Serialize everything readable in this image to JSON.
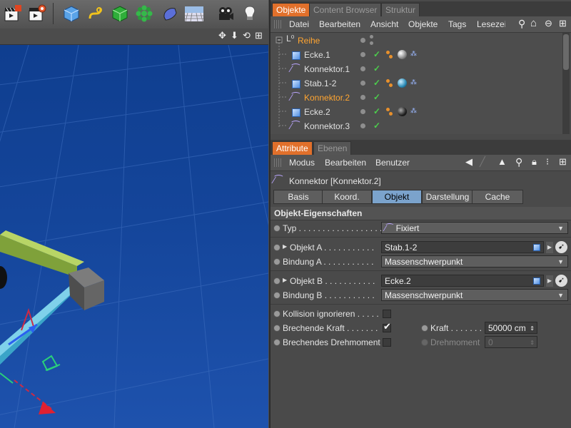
{
  "toolbar": {
    "icons": [
      "render-active-view-icon",
      "render-settings-icon",
      "cube-primitive-icon",
      "spline-icon",
      "nurbs-icon",
      "cloner-icon",
      "deformer-icon",
      "floor-icon",
      "camera-icon",
      "light-icon"
    ]
  },
  "viewport": {
    "nav_icons": [
      "move-arrows-icon",
      "down-arrow-icon",
      "rotate-icon",
      "maximize-icon"
    ]
  },
  "object_manager": {
    "tabs": [
      "Objekte",
      "Content Browser",
      "Struktur"
    ],
    "menu": [
      "Datei",
      "Bearbeiten",
      "Ansicht",
      "Objekte",
      "Tags",
      "Lesezeichen"
    ],
    "rows": [
      {
        "name": "Reihe",
        "type": "null",
        "selected": true
      },
      {
        "name": "Ecke.1",
        "type": "cube",
        "tags": "gray"
      },
      {
        "name": "Konnektor.1",
        "type": "connector"
      },
      {
        "name": "Stab.1-2",
        "type": "cube",
        "tags": "blue"
      },
      {
        "name": "Konnektor.2",
        "type": "connector",
        "selected": true
      },
      {
        "name": "Ecke.2",
        "type": "cube",
        "tags": "dark"
      },
      {
        "name": "Konnektor.3",
        "type": "connector"
      }
    ]
  },
  "attribute_manager": {
    "tabs": [
      "Attribute",
      "Ebenen"
    ],
    "menu": [
      "Modus",
      "Bearbeiten",
      "Benutzer"
    ],
    "object_title": "Konnektor [Konnektor.2]",
    "sub_tabs": [
      "Basis",
      "Koord.",
      "Objekt",
      "Darstellung",
      "Cache"
    ],
    "active_sub_tab": "Objekt",
    "section_title": "Objekt-Eigenschaften",
    "typ_label": "Typ . . . . . . . . . . . . . . . . . . . .",
    "typ_value": "Fixiert",
    "objekt_a_label": "Objekt A . . . . . . . . . . .",
    "objekt_a_value": "Stab.1-2",
    "bindung_a_label": "Bindung A . . . . . . . . . . .",
    "bindung_a_value": "Massenschwerpunkt",
    "objekt_b_label": "Objekt B . . . . . . . . . . .",
    "objekt_b_value": "Ecke.2",
    "bindung_b_label": "Bindung B . . . . . . . . . . .",
    "bindung_b_value": "Massenschwerpunkt",
    "kollision_label": "Kollision ignorieren . . . . .",
    "brechende_kraft_label": "Brechende Kraft . . . . . . .",
    "brechende_kraft_checked": true,
    "kraft_label": "Kraft . . . . . . . .",
    "kraft_value": "50000 cm",
    "brechendes_drehmoment_label": "Brechendes Drehmoment",
    "drehmoment_label": "Drehmoment",
    "drehmoment_value": "0"
  }
}
